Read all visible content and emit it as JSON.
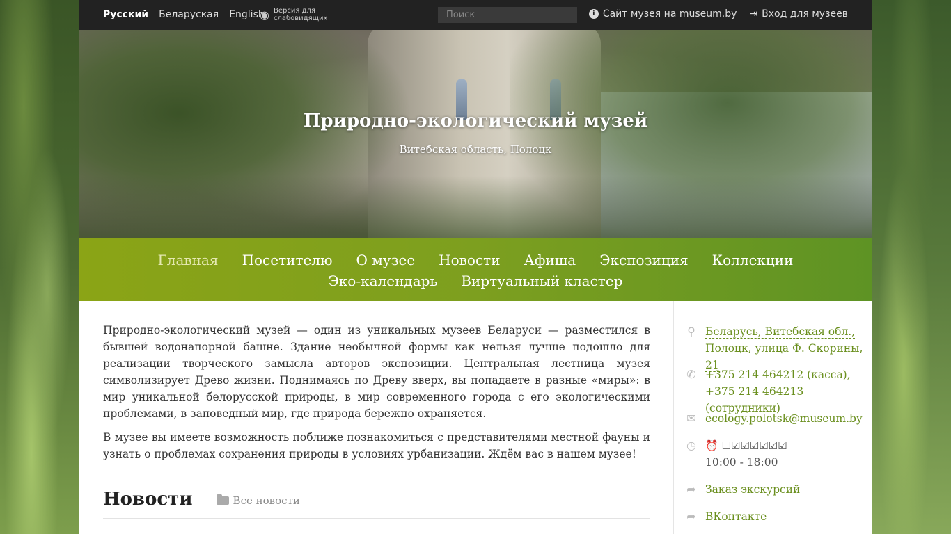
{
  "topbar": {
    "languages": [
      {
        "label": "Русский",
        "active": true
      },
      {
        "label": "Беларуская",
        "active": false
      },
      {
        "label": "English",
        "active": false
      }
    ],
    "lowvision_label": "Версия для слабовидящих",
    "search_placeholder": "Поиск",
    "museum_site_label": "Сайт музея на museum.by",
    "login_label": "Вход для музеев"
  },
  "hero": {
    "title": "Природно-экологический музей",
    "location": "Витебская область, Полоцк"
  },
  "nav": {
    "items": [
      "Главная",
      "Посетителю",
      "О музее",
      "Новости",
      "Афиша",
      "Экспозиция",
      "Коллекции",
      "Эко-календарь",
      "Виртуальный кластер"
    ]
  },
  "main": {
    "paragraphs": [
      "Природно-экологический музей — один из уникальных музеев Беларуси — разместился в бывшей водонапорной башне. Здание необычной формы как нельзя лучше подошло для реализации творческого замысла авторов экспозиции. Центральная лестница музея символизирует Древо жизни. Поднимаясь по Древу вверх, вы попадаете в разные «миры»: в мир уникальной белорусской природы, в мир современного города с его экологическими проблемами, в заповедный мир, где природа бережно охраняется.",
      "В музее вы имеете возможность поближе познакомиться с представителями местной фауны и узнать о проблемах сохранения природы в условиях урбанизации. Ждём вас в нашем музее!"
    ],
    "news_title": "Новости",
    "all_news_label": "Все новости"
  },
  "sidebar": {
    "address_line1": "Беларусь, Витебская обл.,",
    "address_line2": "Полоцк, улица Ф. Скорины, 21",
    "phone1": "+375 214 464212 (касса),",
    "phone2": "+375 214 464213 (сотрудники)",
    "email": "ecology.polotsk@museum.by",
    "schedule_days": "⏰ ☐☑☑☑☑☑☑",
    "schedule_hours": "10:00 - 18:00",
    "excursion_label": "Заказ экскурсий",
    "vk_label": "ВКонтакте"
  }
}
